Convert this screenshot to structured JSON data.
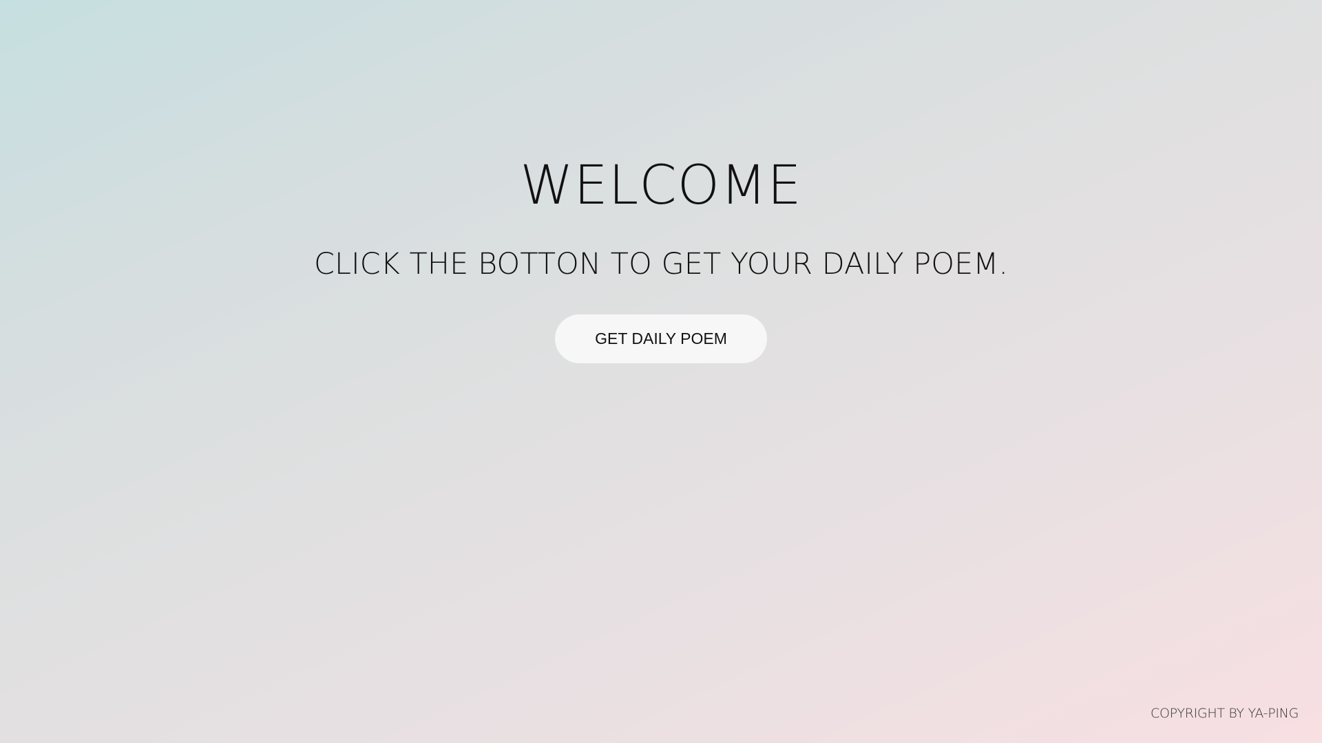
{
  "page": {
    "title": "WELCOME",
    "subtitle": "CLICK THE BOTTON TO GET YOUR DAILY POEM.",
    "button_label": "GET DAILY POEM",
    "footer": "COPYRIGHT BY YA-PING"
  },
  "colors": {
    "gradient_start": "#c6dfe0",
    "gradient_end": "#f8dfe2",
    "button_background": "#f7f7f7",
    "text": "#111111"
  }
}
